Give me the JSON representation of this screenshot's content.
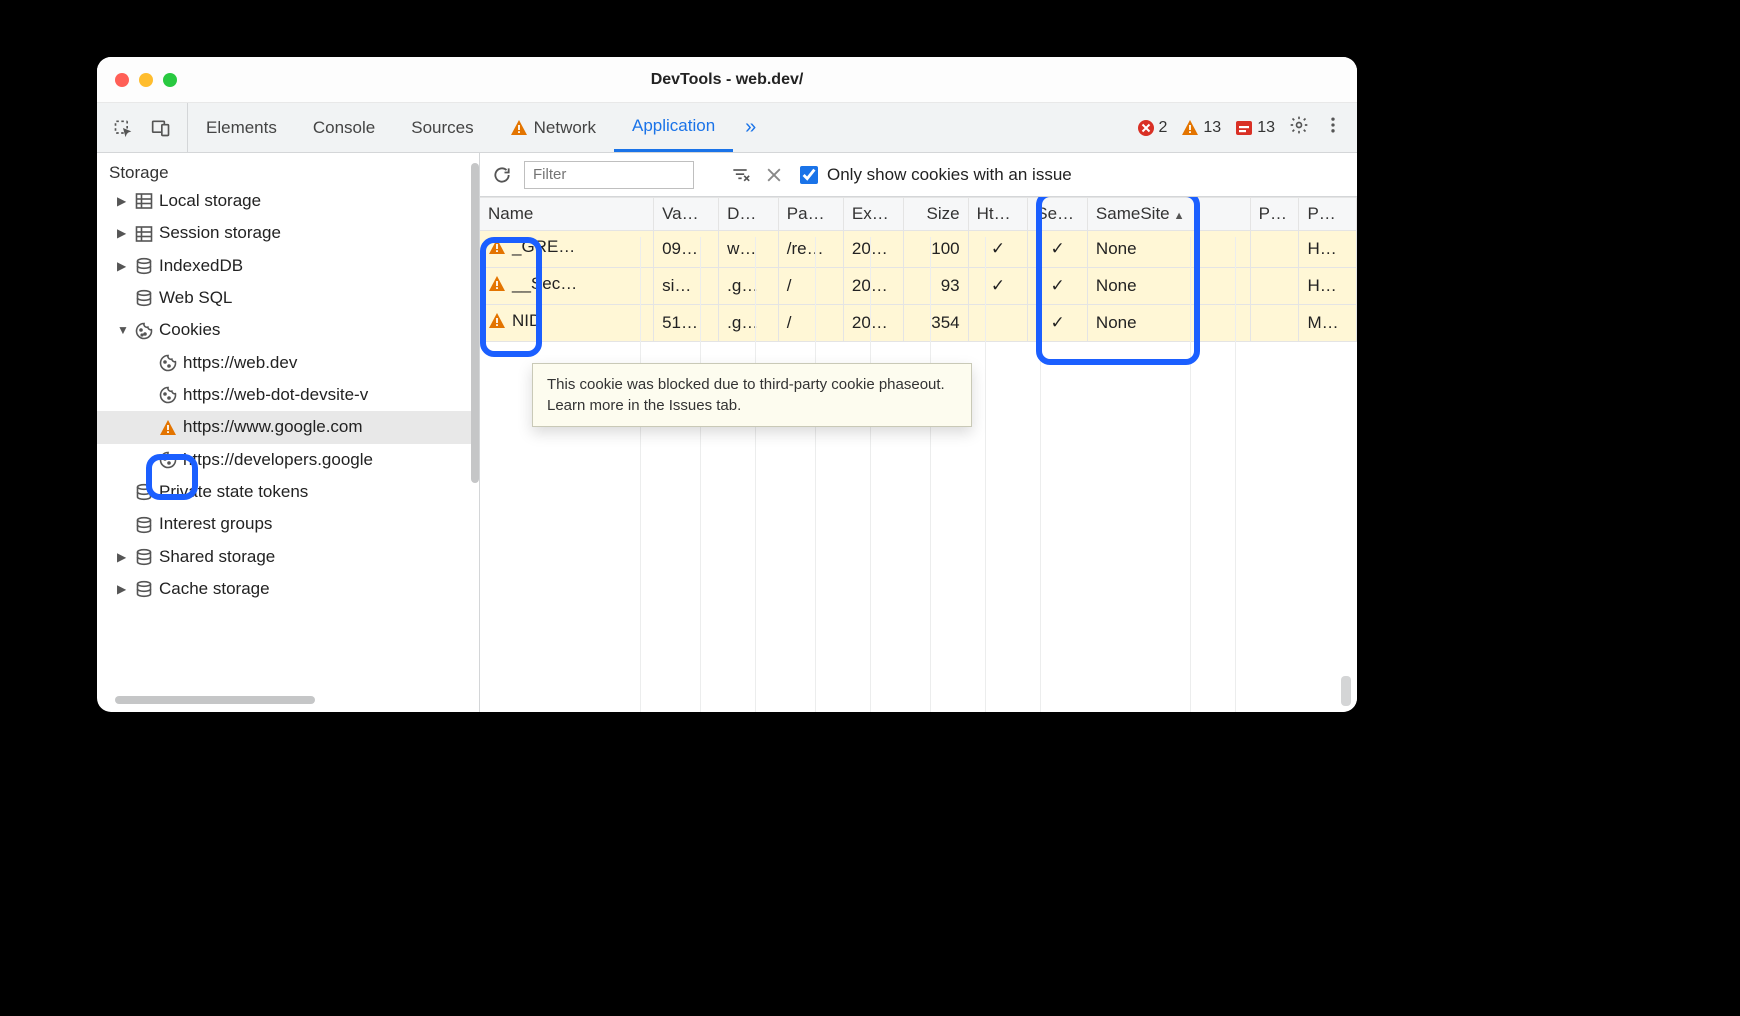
{
  "window": {
    "title": "DevTools - web.dev/"
  },
  "tabs": {
    "elements": "Elements",
    "console": "Console",
    "sources": "Sources",
    "network": "Network",
    "application": "Application"
  },
  "badges": {
    "errors": "2",
    "warnings": "13",
    "issues": "13"
  },
  "sidebar": {
    "heading": "Storage",
    "items": {
      "local_storage": "Local storage",
      "session_storage": "Session storage",
      "indexeddb": "IndexedDB",
      "web_sql": "Web SQL",
      "cookies": "Cookies",
      "cookie_origins": [
        "https://web.dev",
        "https://web-dot-devsite-v",
        "https://www.google.com",
        "https://developers.google"
      ],
      "private_state_tokens": "Private state tokens",
      "interest_groups": "Interest groups",
      "shared_storage": "Shared storage",
      "cache_storage": "Cache storage"
    }
  },
  "toolbar": {
    "filter_placeholder": "Filter",
    "checkbox_label": "Only show cookies with an issue"
  },
  "columns": {
    "name": "Name",
    "value": "Va…",
    "domain": "D…",
    "path": "Pa…",
    "expires": "Ex…",
    "size": "Size",
    "http": "Ht…",
    "secure": "Se…",
    "samesite": "SameSite",
    "partition": "P…",
    "priority": "P…"
  },
  "rows": [
    {
      "name": "_GRE…",
      "value": "09…",
      "domain": "w…",
      "path": "/re…",
      "expires": "20…",
      "size": "100",
      "http": "✓",
      "secure": "✓",
      "samesite": "None",
      "partition": "",
      "priority": "H…"
    },
    {
      "name": "__Sec…",
      "value": "si…",
      "domain": ".g…",
      "path": "/",
      "expires": "20…",
      "size": "93",
      "http": "✓",
      "secure": "✓",
      "samesite": "None",
      "partition": "",
      "priority": "H…"
    },
    {
      "name": "NID",
      "value": "51…",
      "domain": ".g…",
      "path": "/",
      "expires": "20…",
      "size": "354",
      "http": "",
      "secure": "✓",
      "samesite": "None",
      "partition": "",
      "priority": "M…"
    }
  ],
  "tooltip": "This cookie was blocked due to third-party cookie phaseout. Learn more in the Issues tab."
}
